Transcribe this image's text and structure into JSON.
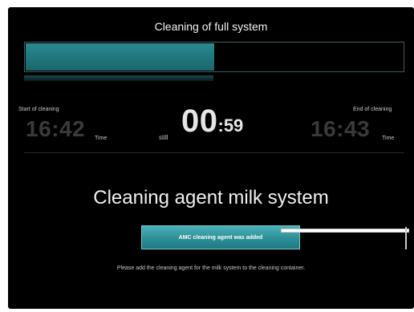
{
  "screen": {
    "title": "Cleaning of full system",
    "progress": 0.5,
    "start_label": "Start of cleaning",
    "start_time": "16:42",
    "start_unit": "Time",
    "still_label": "still",
    "countdown_min": "00",
    "countdown_sec": ":59",
    "end_label": "End of cleaning",
    "end_time": "16:43",
    "end_unit": "Time",
    "heading": "Cleaning agent milk system",
    "action_button": "AMC cleaning agent was added",
    "hint": "Please add the cleaning agent for the milk system to the cleaning container."
  },
  "colors": {
    "background": "#000000",
    "accent": "#2b8e97"
  }
}
